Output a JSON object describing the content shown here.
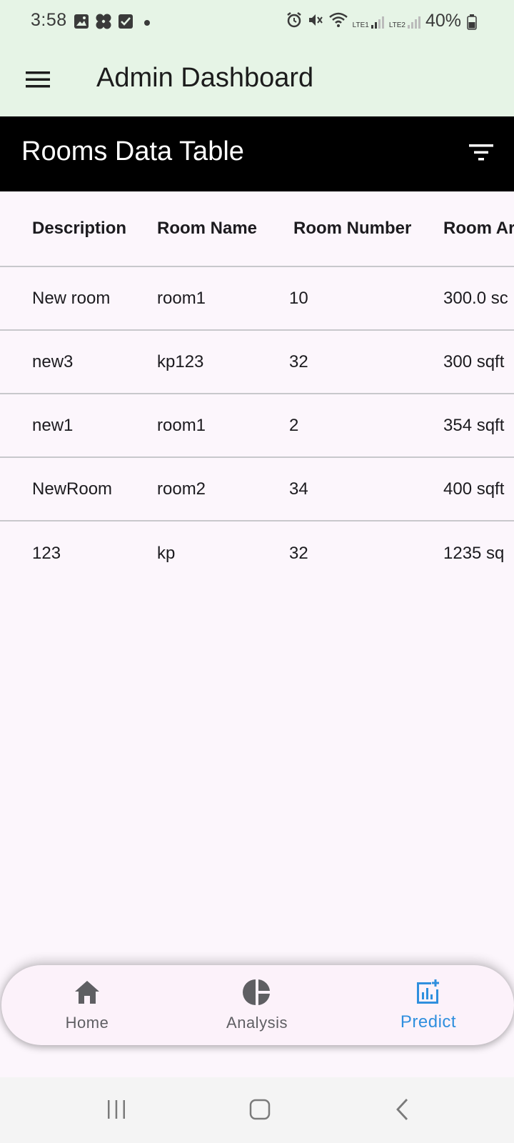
{
  "status_bar": {
    "time": "3:58",
    "battery": "40%",
    "network_1": "LTE1",
    "network_2": "LTE2"
  },
  "app_bar": {
    "title": "Admin Dashboard"
  },
  "section": {
    "title": "Rooms Data Table"
  },
  "table": {
    "headers": [
      "Description",
      "Room Name",
      "Room Number",
      "Room Ar"
    ],
    "rows": [
      [
        "New room",
        "room1",
        "10",
        "300.0 sc"
      ],
      [
        "new3",
        "kp123",
        "32",
        "300 sqft"
      ],
      [
        "new1",
        "room1",
        "2",
        "354 sqft"
      ],
      [
        "NewRoom",
        "room2",
        "34",
        "400 sqft"
      ],
      [
        "123",
        "kp",
        "32",
        "1235 sq"
      ]
    ]
  },
  "bottom_nav": {
    "items": [
      {
        "label": "Home",
        "icon": "home-icon"
      },
      {
        "label": "Analysis",
        "icon": "pie-chart-icon"
      },
      {
        "label": "Predict",
        "icon": "predict-chart-icon",
        "selected": true
      }
    ],
    "accent_color": "#2f8fde"
  }
}
